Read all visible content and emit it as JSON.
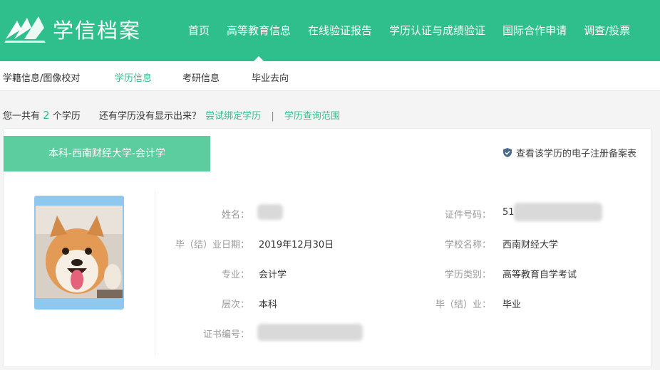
{
  "header": {
    "logo_text": "学信档案",
    "nav": [
      "首页",
      "高等教育信息",
      "在线验证报告",
      "学历认证与成绩验证",
      "国际合作申请",
      "调查/投票"
    ],
    "active_nav_index": 1,
    "brand_color": "#2fbf8c"
  },
  "subnav": {
    "items": [
      "学籍信息/图像校对",
      "学历信息",
      "考研信息",
      "毕业去向"
    ],
    "active_index": 1
  },
  "summary": {
    "prefix": "您一共有",
    "count": "2",
    "suffix": "个学历",
    "hint": "还有学历没有显示出来？",
    "bind_link": "尝试绑定学历",
    "separator": "|",
    "scope_link": "学历查询范围"
  },
  "record": {
    "tab_title": "本科-西南财经大学-会计学",
    "verify_link": "查看该学历的电子注册备案表",
    "photo_icon": "shiba-dog-photo",
    "fields": {
      "name_label": "姓名：",
      "grad_date_label": "毕（结）业日期：",
      "grad_date_value": "2019年12月30日",
      "major_label": "专业：",
      "major_value": "会计学",
      "level_label": "层次：",
      "level_value": "本科",
      "cert_label": "证书编号：",
      "id_label": "证件号码：",
      "id_value": "51",
      "school_label": "学校名称：",
      "school_value": "西南财经大学",
      "category_label": "学历类别：",
      "category_value": "高等教育自学考试",
      "status_label": "毕（结）业：",
      "status_value": "毕业"
    }
  }
}
